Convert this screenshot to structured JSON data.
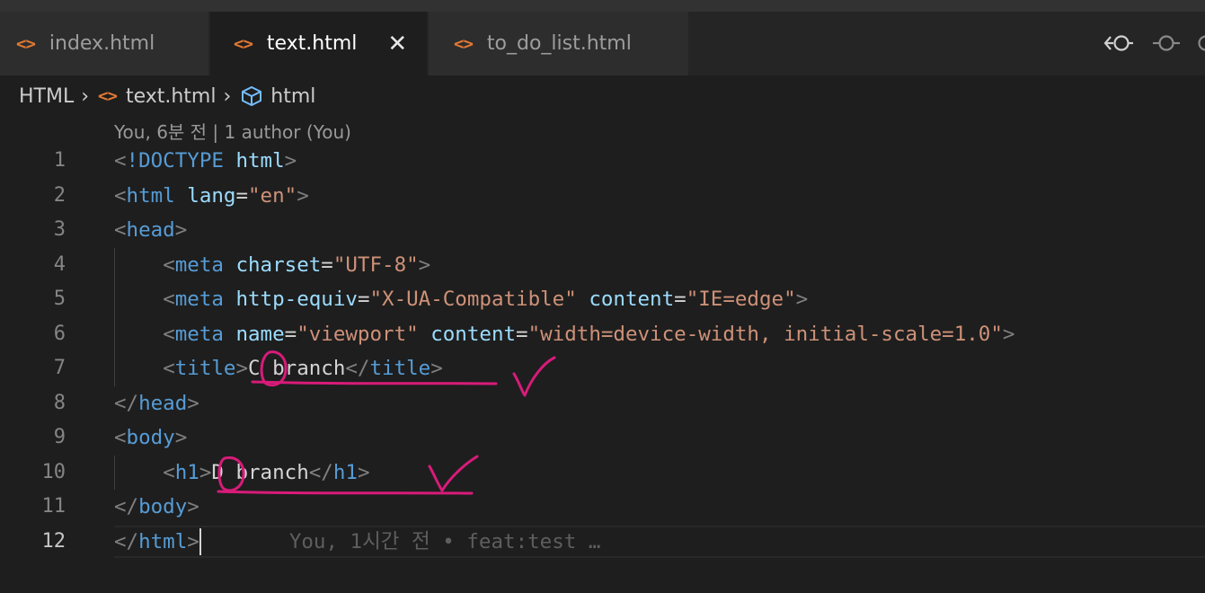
{
  "tabs": [
    {
      "label": "index.html",
      "icon": "<>",
      "active": false
    },
    {
      "label": "text.html",
      "icon": "<>",
      "active": true,
      "close": "✕"
    },
    {
      "label": "to_do_list.html",
      "icon": "<>",
      "active": false
    }
  ],
  "breadcrumb": {
    "root": "HTML",
    "file": "text.html",
    "symbol": "html"
  },
  "codelens": "You, 6분 전 | 1 author (You)",
  "blame": "You, 1시간 전 • feat:test …",
  "lines": [
    {
      "n": "1"
    },
    {
      "n": "2"
    },
    {
      "n": "3"
    },
    {
      "n": "4"
    },
    {
      "n": "5"
    },
    {
      "n": "6"
    },
    {
      "n": "7"
    },
    {
      "n": "8"
    },
    {
      "n": "9"
    },
    {
      "n": "10"
    },
    {
      "n": "11"
    },
    {
      "n": "12"
    }
  ],
  "code": {
    "l1_doctype": "!DOCTYPE",
    "l1_html": "html",
    "l2_tag": "html",
    "l2_attr": "lang",
    "l2_val": "\"en\"",
    "l3_tag": "head",
    "l4_tag": "meta",
    "l4_attr": "charset",
    "l4_val": "\"UTF-8\"",
    "l5_tag": "meta",
    "l5_attr1": "http-equiv",
    "l5_val1": "\"X-UA-Compatible\"",
    "l5_attr2": "content",
    "l5_val2": "\"IE=edge\"",
    "l6_tag": "meta",
    "l6_attr1": "name",
    "l6_val1": "\"viewport\"",
    "l6_attr2": "content",
    "l6_val2": "\"width=device-width, initial-scale=1.0\"",
    "l7_tag": "title",
    "l7_text": "C branch",
    "l8_tag": "head",
    "l9_tag": "body",
    "l10_tag": "h1",
    "l10_text": "D branch",
    "l11_tag": "body",
    "l12_tag": "html"
  },
  "colors": {
    "tag": "#569cd6",
    "attribute": "#9cdcfe",
    "string": "#ce9178",
    "annotation": "#d81b7a",
    "file_icon": "#e37933"
  }
}
